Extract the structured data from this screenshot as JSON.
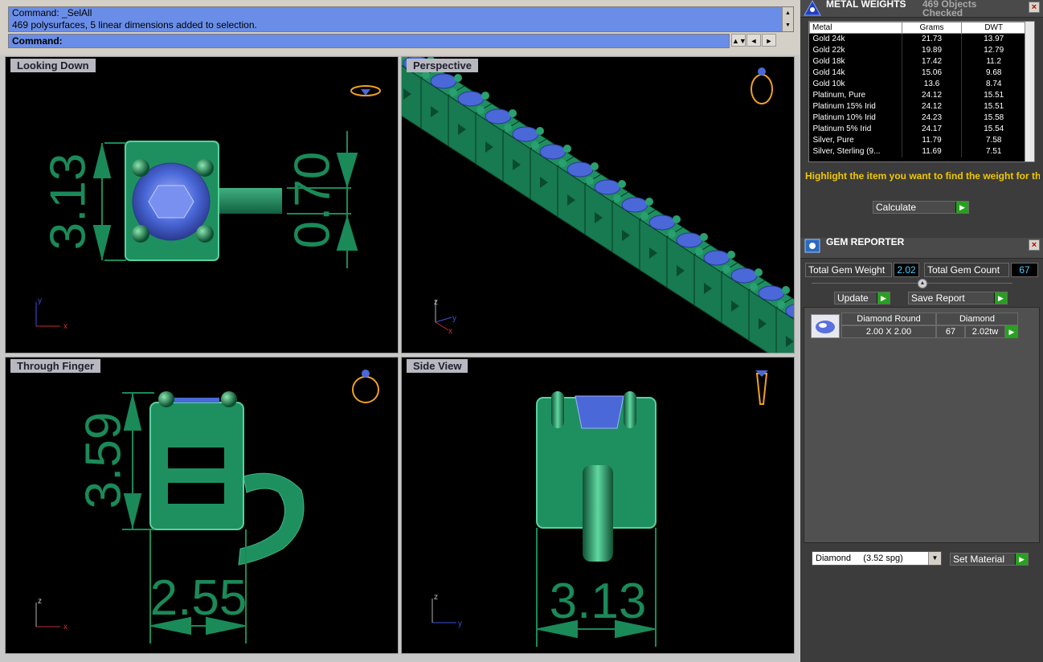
{
  "command": {
    "history_line1": "Command: _SelAll",
    "history_line2": "469 polysurfaces, 5 linear dimensions added to selection.",
    "prompt": "Command:"
  },
  "viewports": {
    "top_left": {
      "title": "Looking Down",
      "dim1": "3.13",
      "dim2": "0.70",
      "axis_a": "y",
      "axis_b": "x"
    },
    "top_right": {
      "title": "Perspective",
      "axis_a": "z",
      "axis_b": "y",
      "axis_c": "x"
    },
    "bottom_left": {
      "title": "Through Finger",
      "dim1": "3.59",
      "dim2": "2.55",
      "axis_a": "z",
      "axis_b": "x"
    },
    "bottom_right": {
      "title": "Side View",
      "dim1": "3.13",
      "axis_a": "z",
      "axis_b": "y"
    }
  },
  "metal_weights": {
    "title": "METAL WEIGHTS",
    "subtitle": "469 Objects Checked",
    "columns": [
      "Metal",
      "Grams",
      "DWT"
    ],
    "rows": [
      [
        "Gold 24k",
        "21.73",
        "13.97"
      ],
      [
        "Gold 22k",
        "19.89",
        "12.79"
      ],
      [
        "Gold 18k",
        "17.42",
        "11.2"
      ],
      [
        "Gold 14k",
        "15.06",
        "9.68"
      ],
      [
        "Gold 10k",
        "13.6",
        "8.74"
      ],
      [
        "Platinum, Pure",
        "24.12",
        "15.51"
      ],
      [
        "Platinum 15% Irid",
        "24.12",
        "15.51"
      ],
      [
        "Platinum 10% Irid",
        "24.23",
        "15.58"
      ],
      [
        "Platinum 5% Irid",
        "24.17",
        "15.54"
      ],
      [
        "Silver, Pure",
        "11.79",
        "7.58"
      ],
      [
        "Silver, Sterling (9...",
        "11.69",
        "7.51"
      ]
    ],
    "hint": "Highlight the item you want to find the weight for then press go.",
    "calculate_label": "Calculate"
  },
  "gem_reporter": {
    "title": "GEM REPORTER",
    "total_weight_label": "Total Gem Weight",
    "total_weight_value": "2.02",
    "total_count_label": "Total Gem Count",
    "total_count_value": "67",
    "update_label": "Update",
    "save_report_label": "Save Report",
    "gem": {
      "shape": "Diamond Round",
      "material": "Diamond",
      "size": "2.00 X 2.00",
      "count": "67",
      "total": "2.02tw"
    },
    "material_select": "Diamond     (3.52 spg)",
    "set_material_label": "Set Material"
  },
  "colors": {
    "metal_green": "#1e9060",
    "gem_blue": "#4a68d8",
    "dim_green": "#1a8a58",
    "panel_bg": "#3c3c3c",
    "accent_yellow": "#f0c800"
  }
}
